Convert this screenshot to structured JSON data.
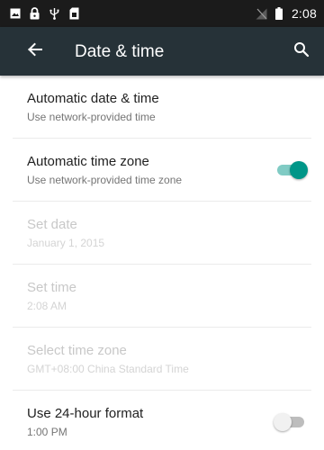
{
  "status_bar": {
    "time": "2:08",
    "left_icons": [
      "image-icon",
      "lock-icon",
      "usb-icon",
      "sim-card-icon"
    ],
    "right_icons": [
      "signal-off-icon",
      "battery-icon"
    ]
  },
  "app_bar": {
    "title": "Date & time",
    "background": "#263238"
  },
  "accent": "#009688",
  "settings": [
    {
      "title": "Automatic date & time",
      "subtitle": "Use network-provided time",
      "enabled": true
    },
    {
      "title": "Automatic time zone",
      "subtitle": "Use network-provided time zone",
      "enabled": true,
      "toggle": "on"
    },
    {
      "title": "Set date",
      "subtitle": "January 1, 2015",
      "enabled": false
    },
    {
      "title": "Set time",
      "subtitle": "2:08 AM",
      "enabled": false
    },
    {
      "title": "Select time zone",
      "subtitle": "GMT+08:00 China Standard Time",
      "enabled": false
    },
    {
      "title": "Use 24-hour format",
      "subtitle": "1:00 PM",
      "enabled": true,
      "toggle": "off"
    }
  ]
}
